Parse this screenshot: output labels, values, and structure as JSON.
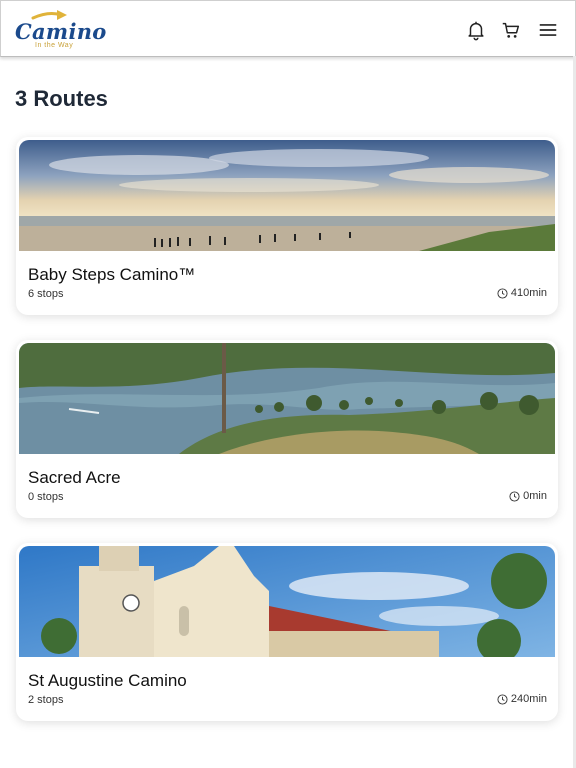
{
  "header": {
    "logo_text": "Camino",
    "logo_tagline": "In the Way",
    "icons": [
      "bell-icon",
      "cart-icon",
      "menu-icon"
    ]
  },
  "page_title": "3 Routes",
  "routes": [
    {
      "title": "Baby Steps Camino™",
      "stops": "6 stops",
      "duration": "410min"
    },
    {
      "title": "Sacred Acre",
      "stops": "0 stops",
      "duration": "0min"
    },
    {
      "title": "St Augustine Camino",
      "stops": "2 stops",
      "duration": "240min"
    }
  ],
  "colors": {
    "brand_blue": "#1b4a8c",
    "brand_gold": "#e0b33a",
    "text": "#1f2937"
  }
}
